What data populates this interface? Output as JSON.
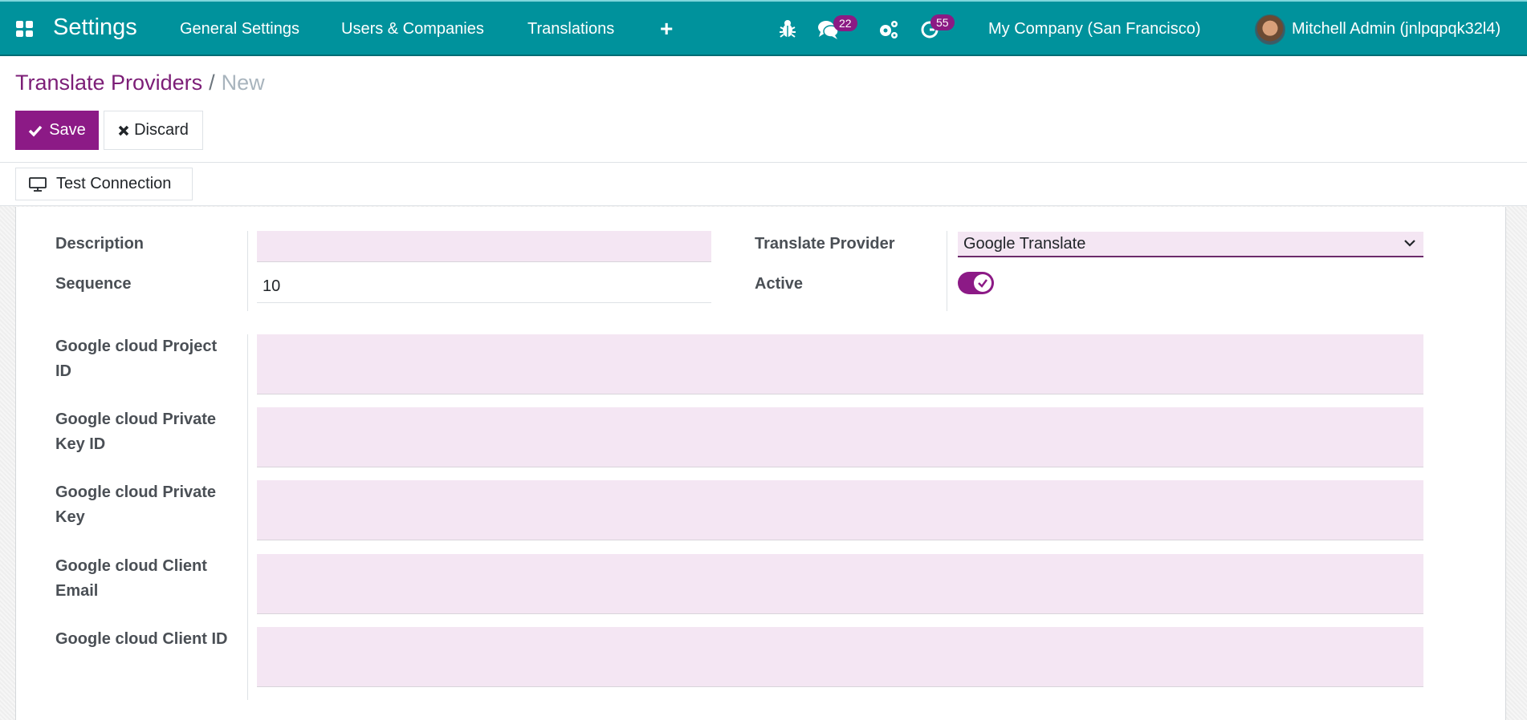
{
  "navbar": {
    "app_title": "Settings",
    "menu": [
      {
        "label": "General Settings"
      },
      {
        "label": "Users & Companies"
      },
      {
        "label": "Translations"
      }
    ],
    "icons": {
      "apps": "apps-grid-icon",
      "add": "plus-icon",
      "debug": "bug-icon",
      "messages": "chat-icon",
      "settings": "gears-icon",
      "activities": "clock-icon"
    },
    "messages_count": "22",
    "activities_count": "55",
    "company": "My Company (San Francisco)",
    "user": "Mitchell Admin (jnlpqpqk32l4)",
    "colors": {
      "navbar": "#00929c",
      "badge": "#8b1a84"
    }
  },
  "control_panel": {
    "breadcrumb_parent": "Translate Providers",
    "breadcrumb_separator": "/",
    "breadcrumb_current": "New",
    "save_label": "Save",
    "discard_label": "Discard",
    "test_connection_label": "Test Connection",
    "accent_color": "#8c1a86"
  },
  "form": {
    "left": [
      {
        "label": "Description",
        "value": ""
      },
      {
        "label": "Sequence",
        "value": "10"
      }
    ],
    "right": [
      {
        "label": "Translate Provider",
        "value": "Google Translate"
      },
      {
        "label": "Active",
        "value": true
      }
    ],
    "google": [
      {
        "label_line1": "Google cloud Project",
        "label_line2": "ID",
        "value": ""
      },
      {
        "label_line1": "Google cloud Private",
        "label_line2": "Key ID",
        "value": ""
      },
      {
        "label_line1": "Google cloud Private",
        "label_line2": "Key",
        "value": ""
      },
      {
        "label_line1": "Google cloud Client",
        "label_line2": "Email",
        "value": ""
      },
      {
        "label_line1": "Google cloud Client ID",
        "label_line2": "",
        "value": ""
      }
    ],
    "required_field_color": "#f4e6f3"
  }
}
